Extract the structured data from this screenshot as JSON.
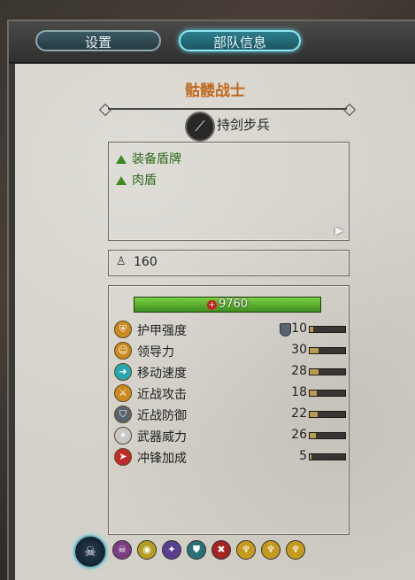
{
  "tabs": [
    {
      "label": "设置",
      "active": false
    },
    {
      "label": "部队信息",
      "active": true
    }
  ],
  "unit": {
    "name": "骷髅战士",
    "type_label": "持剑步兵",
    "type_icon": "sword-icon"
  },
  "attributes": [
    {
      "label": "装备盾牌"
    },
    {
      "label": "肉盾"
    }
  ],
  "cost": {
    "value": "160",
    "icon": "upkeep-icon"
  },
  "health": {
    "value": "9760",
    "icon": "health-plus-icon"
  },
  "stats": [
    {
      "label": "护甲强度",
      "value": "10",
      "icon": "armor-icon",
      "bar": 0.1,
      "icon_color": "#c98a1f"
    },
    {
      "label": "领导力",
      "value": "30",
      "icon": "leadership-icon",
      "bar": 0.25,
      "icon_color": "#c98a1f"
    },
    {
      "label": "移动速度",
      "value": "28",
      "icon": "speed-icon",
      "bar": 0.25,
      "icon_color": "#2aa6b0"
    },
    {
      "label": "近战攻击",
      "value": "18",
      "icon": "melee-attack-icon",
      "bar": 0.2,
      "icon_color": "#c98a1f"
    },
    {
      "label": "近战防御",
      "value": "22",
      "icon": "melee-defence-icon",
      "bar": 0.22,
      "icon_color": "#5a6470"
    },
    {
      "label": "武器威力",
      "value": "26",
      "icon": "weapon-strength-icon",
      "bar": 0.18,
      "icon_color": "#c7c7c7"
    },
    {
      "label": "冲锋加成",
      "value": "5",
      "icon": "charge-bonus-icon",
      "bar": 0.05,
      "icon_color": "#c22a2a"
    }
  ],
  "abilities": [
    {
      "icon": "skull-icon",
      "color": "#7b3f7f"
    },
    {
      "icon": "eye-icon",
      "color": "#b59d20"
    },
    {
      "icon": "terror-icon",
      "color": "#5a3f8f"
    },
    {
      "icon": "shield-buff-icon",
      "color": "#2a7077"
    },
    {
      "icon": "fear-icon",
      "color": "#a52323"
    },
    {
      "icon": "undead-icon",
      "color": "#c49b1f"
    },
    {
      "icon": "undead-icon",
      "color": "#c49b1f"
    },
    {
      "icon": "undead-icon",
      "color": "#c49b1f"
    }
  ],
  "colors": {
    "title": "#c0691d",
    "positive": "#2f6b1c",
    "health_bar": "#5aaf2e"
  }
}
